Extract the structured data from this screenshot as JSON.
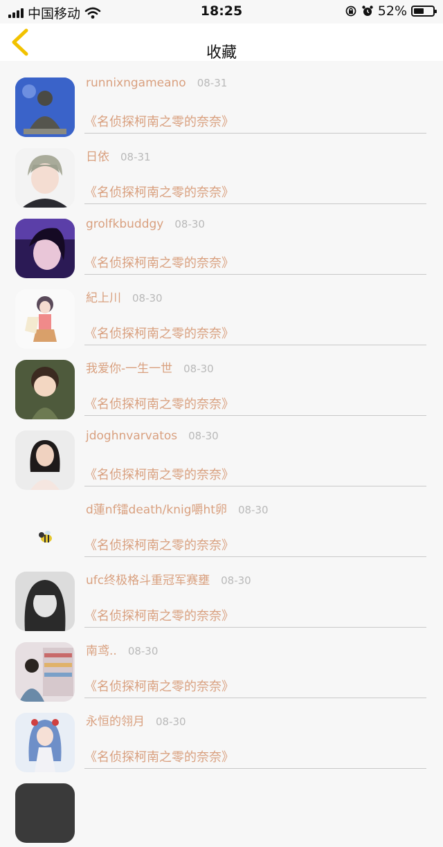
{
  "status_bar": {
    "carrier": "中国移动",
    "time": "18:25",
    "battery": "52%",
    "battery_level": 0.52
  },
  "nav": {
    "title": "收藏",
    "back_icon": "chevron-left-icon",
    "accent": "#f2c200"
  },
  "colors": {
    "name": "#d9a07f",
    "date": "#b9b9b9",
    "divider": "#c8c8c8"
  },
  "favorites": [
    {
      "name": "runnixngameano",
      "date": "08-31",
      "comic": "《名侦探柯南之零的奈奈》"
    },
    {
      "name": "日依",
      "date": "08-31",
      "comic": "《名侦探柯南之零的奈奈》"
    },
    {
      "name": "grolfkbuddgy",
      "date": "08-30",
      "comic": "《名侦探柯南之零的奈奈》"
    },
    {
      "name": "紀上川",
      "date": "08-30",
      "comic": "《名侦探柯南之零的奈奈》"
    },
    {
      "name": "我爱你-一生一世",
      "date": "08-30",
      "comic": "《名侦探柯南之零的奈奈》"
    },
    {
      "name": "jdoghnvarvatos",
      "date": "08-30",
      "comic": "《名侦探柯南之零的奈奈》"
    },
    {
      "name": "d蓮nf镭death/knig嚼ht卵",
      "date": "08-30",
      "comic": "《名侦探柯南之零的奈奈》"
    },
    {
      "name": "ufc终极格斗重冠军赛壅",
      "date": "08-30",
      "comic": "《名侦探柯南之零的奈奈》"
    },
    {
      "name": "南鸢..",
      "date": "08-30",
      "comic": "《名侦探柯南之零的奈奈》"
    },
    {
      "name": "永恒的翎月",
      "date": "08-30",
      "comic": "《名侦探柯南之零的奈奈》"
    }
  ]
}
